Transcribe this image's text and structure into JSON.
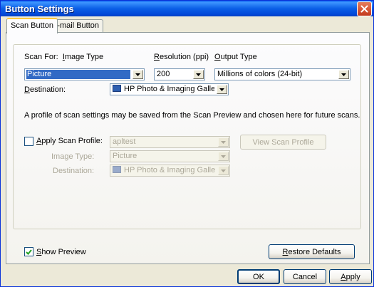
{
  "window": {
    "title": "Button Settings"
  },
  "tabs": [
    {
      "label": "Scan Button",
      "active": true
    },
    {
      "label": "E-mail Button",
      "active": false
    }
  ],
  "scan_for": {
    "label_prefix": "Scan For:",
    "label_accel": "I",
    "label_rest": "mage Type",
    "value": "Picture"
  },
  "resolution": {
    "label_accel": "R",
    "label_rest": "esolution (ppi)",
    "value": "200"
  },
  "output_type": {
    "label_accel": "O",
    "label_rest": "utput Type",
    "value": "Millions of colors (24-bit)"
  },
  "destination": {
    "label_accel": "D",
    "label_rest": "estination:",
    "value": "HP Photo & Imaging Gallery"
  },
  "info_text": "A profile of scan settings may be saved from the Scan Preview and chosen here for future scans.",
  "apply_profile": {
    "checked": false,
    "label_accel": "A",
    "label_rest": "pply Scan Profile:",
    "value": "apltest"
  },
  "view_profile_button": "View Scan Profile",
  "profile_image_type": {
    "label": "Image Type:",
    "value": "Picture"
  },
  "profile_destination": {
    "label": "Destination:",
    "value": "HP Photo & Imaging Gallery"
  },
  "show_preview": {
    "checked": true,
    "label_accel": "S",
    "label_rest": "how Preview"
  },
  "restore_defaults": {
    "accel": "R",
    "rest": "estore Defaults"
  },
  "footer": {
    "ok": "OK",
    "cancel": "Cancel",
    "apply_accel": "A",
    "apply_rest": "pply"
  },
  "colors": {
    "title_blue": "#0349D9",
    "selection": "#316AC5",
    "dialog_bg": "#ECE9D8"
  }
}
